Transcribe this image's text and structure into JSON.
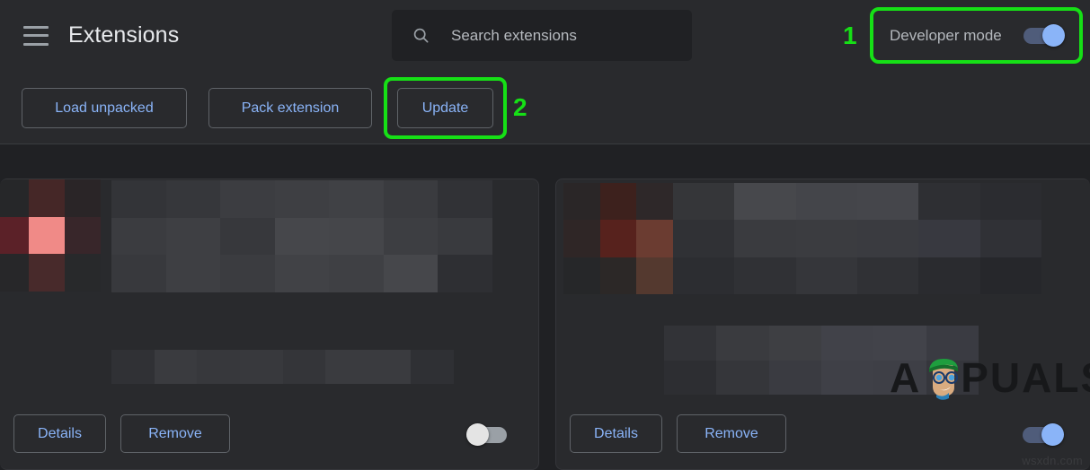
{
  "header": {
    "menu_icon": "hamburger-menu-icon",
    "title": "Extensions",
    "search": {
      "icon": "search-icon",
      "placeholder": "Search extensions",
      "value": ""
    },
    "developer_mode": {
      "label": "Developer mode",
      "toggle_state": "on",
      "highlight_color": "#16e016",
      "callout": "1"
    }
  },
  "toolbar": {
    "load_unpacked_label": "Load unpacked",
    "pack_extension_label": "Pack extension",
    "update_label": "Update",
    "update_highlight_color": "#16e016",
    "update_callout": "2"
  },
  "cards": [
    {
      "name": "extension-card-left",
      "title_censored": true,
      "details_label": "Details",
      "remove_label": "Remove",
      "toggle_state": "off"
    },
    {
      "name": "extension-card-right",
      "title_censored": true,
      "details_label": "Details",
      "remove_label": "Remove",
      "toggle_state": "on"
    }
  ],
  "watermarks": {
    "brand_before": "A",
    "brand_after": "PUALS",
    "site": "wsxdn.com"
  },
  "colors": {
    "page_background": "#202124",
    "panel_background": "#292a2d",
    "link_blue": "#8ab4f8",
    "toggle_on_track": "#4f5c7a",
    "toggle_off_track": "#9aa0a6",
    "highlight_green": "#16e016"
  }
}
